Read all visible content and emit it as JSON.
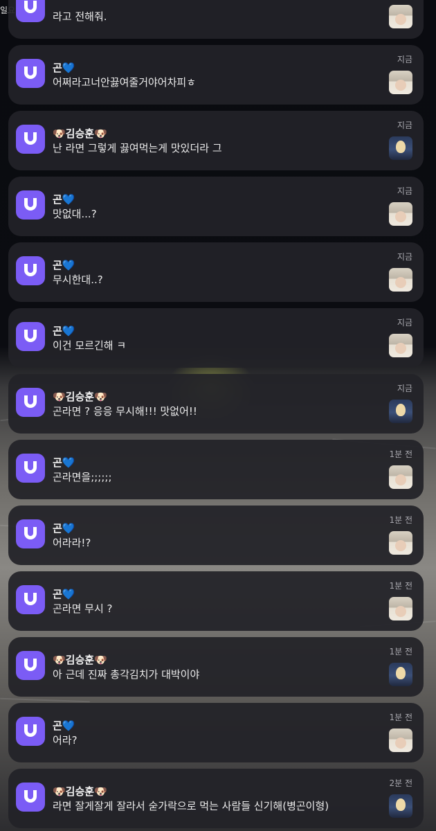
{
  "status_bar": {
    "day_text": "일요일"
  },
  "top_partial": {
    "message": "라고 전해줘."
  },
  "notifications": [
    {
      "sender": "곤💙",
      "message": "어쩌라고너안끓여줄거야어차피ㅎ",
      "time": "지금",
      "avatar": "gon-avatar"
    },
    {
      "sender": "🐶김승훈🐶",
      "message": "난 라면 그렇게 끓여먹는게 맛있더라 그",
      "time": "지금",
      "avatar": "seunghoon-avatar"
    },
    {
      "sender": "곤💙",
      "message": "맛없대...?",
      "time": "지금",
      "avatar": "gon-avatar"
    },
    {
      "sender": "곤💙",
      "message": "무시한대..?",
      "time": "지금",
      "avatar": "gon-avatar"
    },
    {
      "sender": "곤💙",
      "message": "이건 모르긴해 ㅋ",
      "time": "지금",
      "avatar": "gon-avatar"
    },
    {
      "sender": "🐶김승훈🐶",
      "message": "곤라면 ? 응응 무시해!!! 맛없어!!",
      "time": "지금",
      "avatar": "seunghoon-avatar"
    },
    {
      "sender": "곤💙",
      "message": "곤라면을;;;;;;",
      "time": "1분 전",
      "avatar": "gon-avatar"
    },
    {
      "sender": "곤💙",
      "message": "어라라!?",
      "time": "1분 전",
      "avatar": "gon-avatar"
    },
    {
      "sender": "곤💙",
      "message": "곤라면 무시 ?",
      "time": "1분 전",
      "avatar": "gon-avatar"
    },
    {
      "sender": "🐶김승훈🐶",
      "message": "아 근데 진짜 총각김치가 대박이야",
      "time": "1분 전",
      "avatar": "seunghoon-avatar"
    },
    {
      "sender": "곤💙",
      "message": "어라?",
      "time": "1분 전",
      "avatar": "gon-avatar"
    },
    {
      "sender": "🐶김승훈🐶",
      "message": "라면 잘게잘게 잘라서 숟가락으로 먹는 사람들 신기해(병곤이형)",
      "time": "2분 전",
      "avatar": "seunghoon-avatar"
    }
  ],
  "colors": {
    "app_icon": "#7b5cf5",
    "card_bg": "#222228"
  }
}
